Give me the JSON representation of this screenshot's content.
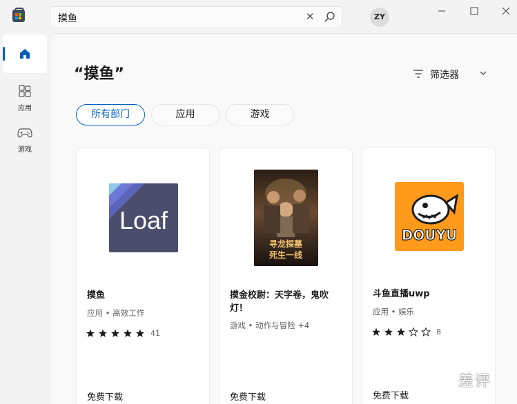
{
  "search": {
    "value": "摸鱼"
  },
  "user": {
    "initials": "ZY"
  },
  "sidebar": {
    "items": [
      {
        "label": "",
        "icon": "home-icon",
        "selected": true
      },
      {
        "label": "应用",
        "icon": "apps-icon"
      },
      {
        "label": "游戏",
        "icon": "gamepad-icon"
      }
    ]
  },
  "page": {
    "title": "“摸鱼”"
  },
  "filter": {
    "label": "筛选器"
  },
  "chips": [
    {
      "label": "所有部门",
      "selected": true
    },
    {
      "label": "应用"
    },
    {
      "label": "游戏"
    }
  ],
  "cards": [
    {
      "name": "摸鱼",
      "category": "应用 • 高效工作",
      "stars": 5,
      "rating_count": "41",
      "price": "免费下载",
      "icon_text": "Loaf",
      "colors": {
        "bg": "#4a4d6b",
        "stripe": "#6b78d6"
      }
    },
    {
      "name": "摸金校尉：天字卷，鬼吹灯！",
      "category": "游戏 • 动作与冒险 +4",
      "stars": 0,
      "rating_count": "",
      "price": "免费下载",
      "icon_text": "寻龙探墓\n死生一线"
    },
    {
      "name": "斗鱼直播uwp",
      "category": "应用 • 娱乐",
      "stars": 3,
      "rating_count": "8",
      "price": "免费下载",
      "icon_text": "DOUYU",
      "colors": {
        "bg": "#ff9a1a"
      }
    }
  ],
  "watermark": "差评",
  "colors": {
    "accent": "#005fb8",
    "background": "#f3f3f3",
    "card": "#ffffff"
  }
}
